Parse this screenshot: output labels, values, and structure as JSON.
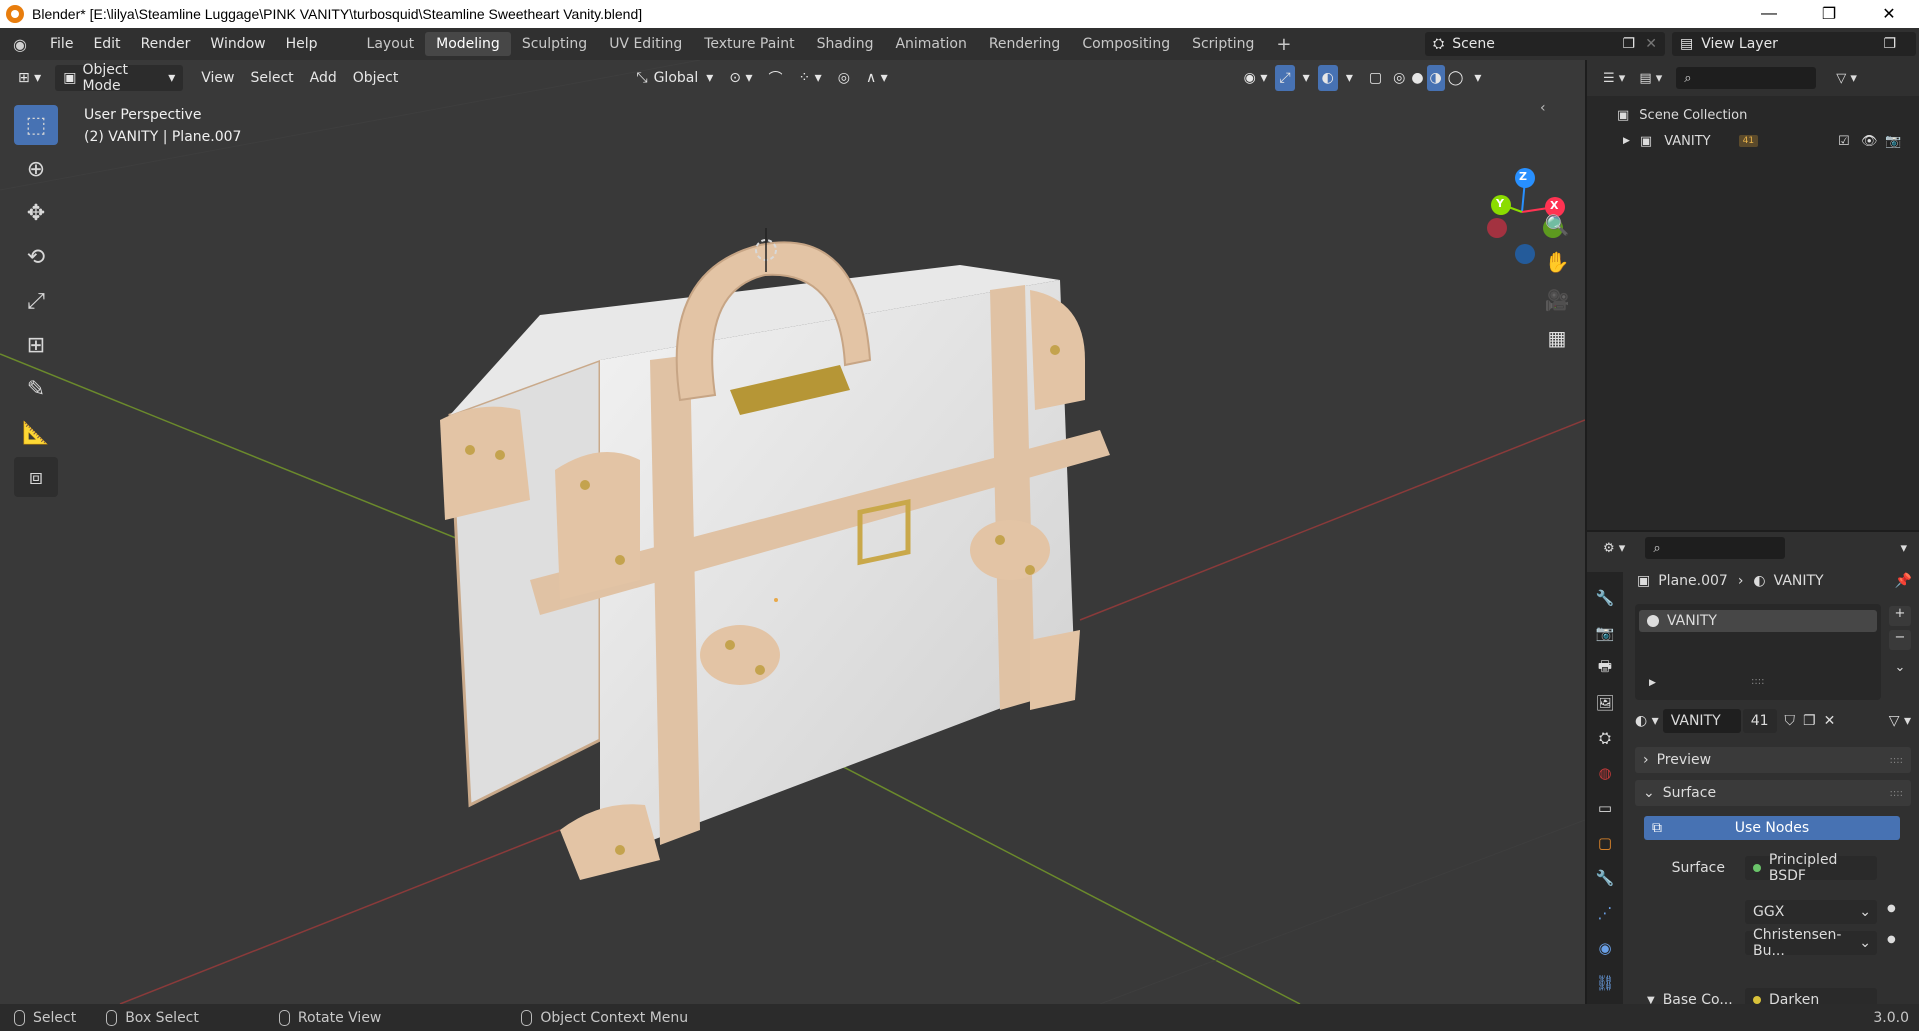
{
  "window": {
    "title": "Blender* [E:\\lilya\\Steamline Luggage\\PINK VANITY\\turbosquid\\Steamline Sweetheart Vanity.blend]",
    "minimize": "—",
    "restore": "❐",
    "close": "✕"
  },
  "menu": [
    "File",
    "Edit",
    "Render",
    "Window",
    "Help"
  ],
  "workspaces": [
    {
      "label": "Layout",
      "active": false
    },
    {
      "label": "Modeling",
      "active": true
    },
    {
      "label": "Sculpting",
      "active": false
    },
    {
      "label": "UV Editing",
      "active": false
    },
    {
      "label": "Texture Paint",
      "active": false
    },
    {
      "label": "Shading",
      "active": false
    },
    {
      "label": "Animation",
      "active": false
    },
    {
      "label": "Rendering",
      "active": false
    },
    {
      "label": "Compositing",
      "active": false
    },
    {
      "label": "Scripting",
      "active": false
    }
  ],
  "add_workspace": "+",
  "scene": {
    "label": "Scene",
    "view_layer": "View Layer"
  },
  "viewport": {
    "mode": "Object Mode",
    "menus": [
      "View",
      "Select",
      "Add",
      "Object"
    ],
    "orientation": "Global",
    "perspective_label": "User Perspective",
    "object_info": "(2)  VANITY | Plane.007",
    "gizmo_axes": {
      "x": "X",
      "y": "Y",
      "z": "Z"
    }
  },
  "outliner": {
    "root": "Scene Collection",
    "items": [
      {
        "name": "VANITY",
        "badge": "41"
      }
    ]
  },
  "properties": {
    "breadcrumb_object": "Plane.007",
    "breadcrumb_material": "VANITY",
    "slot_name": "VANITY",
    "material_name": "VANITY",
    "user_count": "41",
    "panels": {
      "preview": "Preview",
      "surface": "Surface"
    },
    "use_nodes": "Use Nodes",
    "surface_label": "Surface",
    "surface_value": "Principled BSDF",
    "distribution": "GGX",
    "subsurface_method": "Christensen-Bu...",
    "base_color_label": "Base Co...",
    "base_color_value": "Darken",
    "dot_color_green": "#6ac46a",
    "dot_color_yellow": "#d9c23a"
  },
  "status": {
    "select": "Select",
    "box_select": "Box Select",
    "rotate_view": "Rotate View",
    "context_menu": "Object Context Menu",
    "version": "3.0.0"
  },
  "colors": {
    "accent_blue": "#4772b3",
    "axis_x": "#ff3352",
    "axis_y": "#8bdc00",
    "axis_z": "#2890ff"
  }
}
